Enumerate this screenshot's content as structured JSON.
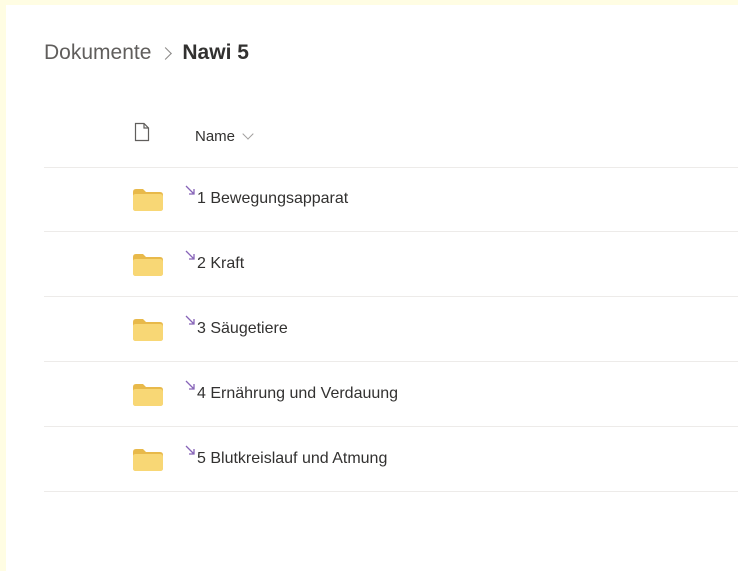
{
  "breadcrumb": {
    "parent": "Dokumente",
    "current": "Nawi 5"
  },
  "list_header": {
    "file_type_icon": "document-icon",
    "name_column": "Name"
  },
  "items": [
    {
      "name": "1 Bewegungsapparat",
      "icon": "folder-icon"
    },
    {
      "name": "2 Kraft",
      "icon": "folder-icon"
    },
    {
      "name": "3 Säugetiere",
      "icon": "folder-icon"
    },
    {
      "name": "4 Ernährung und Verdauung",
      "icon": "folder-icon"
    },
    {
      "name": "5 Blutkreislauf und Atmung",
      "icon": "folder-icon"
    }
  ],
  "colors": {
    "background": "#fffde3",
    "folder": "#f8d775",
    "shortcut_accent": "#8764b8",
    "text": "#323130"
  }
}
